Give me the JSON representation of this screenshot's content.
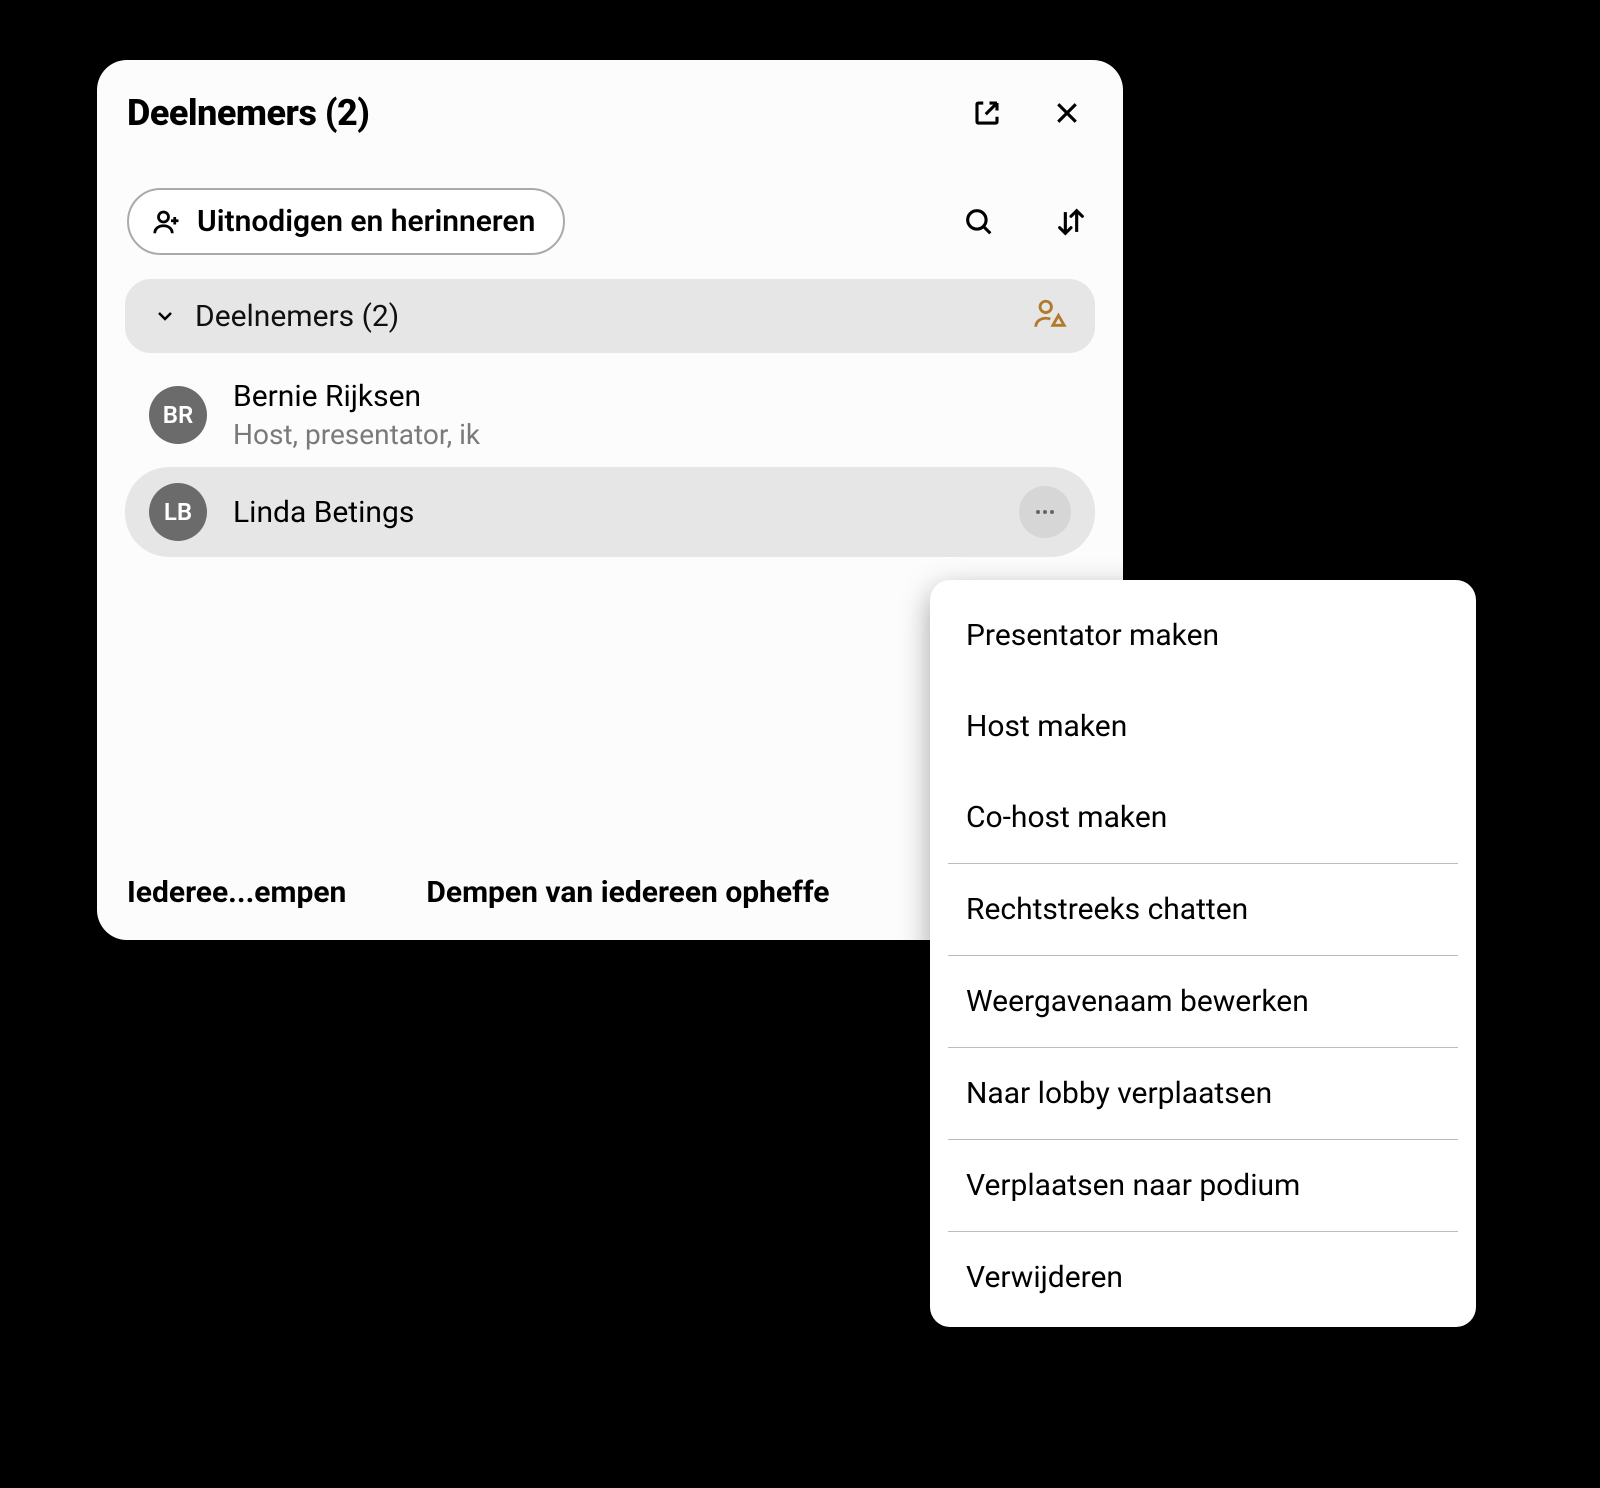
{
  "panel": {
    "title": "Deelnemers (2)",
    "invite_label": "Uitnodigen en herinneren",
    "section_label": "Deelnemers (2)"
  },
  "participants": [
    {
      "initials": "BR",
      "name": "Bernie Rijksen",
      "subtitle": "Host, presentator, ik",
      "selected": false,
      "more": false
    },
    {
      "initials": "LB",
      "name": "Linda Betings",
      "selected": true,
      "more": true
    }
  ],
  "actions": {
    "mute_all": "Iederee...empen",
    "unmute_all": "Dempen van iedereen opheffe"
  },
  "menu": {
    "items": [
      "Presentator maken",
      "Host maken",
      "Co-host maken",
      "Rechtstreeks chatten",
      "Weergavenaam bewerken",
      "Naar lobby verplaatsen",
      "Verplaatsen naar podium",
      "Verwijderen"
    ],
    "dividers_after": [
      2,
      3,
      4,
      5,
      6
    ]
  }
}
